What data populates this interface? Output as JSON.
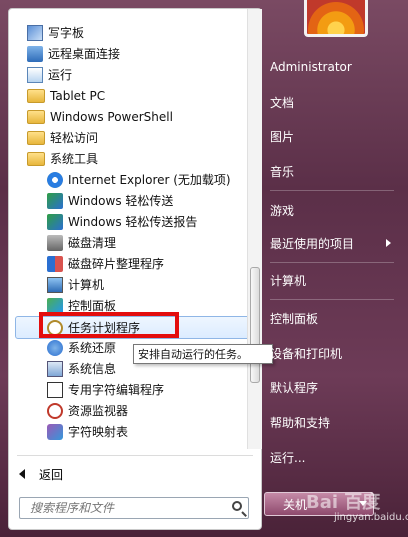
{
  "left_list": {
    "items": [
      {
        "label": "写字板",
        "icon": "wordpad-icon",
        "level": 0
      },
      {
        "label": "远程桌面连接",
        "icon": "remote-desktop-icon",
        "level": 0
      },
      {
        "label": "运行",
        "icon": "run-icon",
        "level": 0
      },
      {
        "label": "Tablet PC",
        "icon": "folder-icon",
        "level": 0
      },
      {
        "label": "Windows PowerShell",
        "icon": "folder-icon",
        "level": 0
      },
      {
        "label": "轻松访问",
        "icon": "folder-icon",
        "level": 0
      },
      {
        "label": "系统工具",
        "icon": "folder-icon",
        "level": 0
      },
      {
        "label": "Internet Explorer (无加载项)",
        "icon": "internet-explorer-icon",
        "level": 1
      },
      {
        "label": "Windows 轻松传送",
        "icon": "easy-transfer-icon",
        "level": 1
      },
      {
        "label": "Windows 轻松传送报告",
        "icon": "easy-transfer-report-icon",
        "level": 1
      },
      {
        "label": "磁盘清理",
        "icon": "disk-cleanup-icon",
        "level": 1
      },
      {
        "label": "磁盘碎片整理程序",
        "icon": "defragmenter-icon",
        "level": 1
      },
      {
        "label": "计算机",
        "icon": "computer-icon",
        "level": 1
      },
      {
        "label": "控制面板",
        "icon": "control-panel-icon",
        "level": 1
      },
      {
        "label": "任务计划程序",
        "icon": "task-scheduler-icon",
        "level": 1,
        "selected": true
      },
      {
        "label": "系统还原",
        "icon": "system-restore-icon",
        "level": 1
      },
      {
        "label": "系统信息",
        "icon": "system-info-icon",
        "level": 1
      },
      {
        "label": "专用字符编辑程序",
        "icon": "char-editor-icon",
        "level": 1
      },
      {
        "label": "资源监视器",
        "icon": "resource-monitor-icon",
        "level": 1
      },
      {
        "label": "字符映射表",
        "icon": "character-map-icon",
        "level": 1
      }
    ],
    "tooltip": "安排自动运行的任务。",
    "back_label": "返回"
  },
  "search": {
    "placeholder": "搜索程序和文件"
  },
  "right_menu": {
    "items": [
      {
        "label": "Administrator"
      },
      {
        "label": "文档"
      },
      {
        "label": "图片"
      },
      {
        "label": "音乐"
      },
      {
        "label": "游戏"
      },
      {
        "label": "最近使用的项目",
        "arrow": true
      },
      {
        "label": "计算机"
      },
      {
        "label": "控制面板"
      },
      {
        "label": "设备和打印机"
      },
      {
        "label": "默认程序"
      },
      {
        "label": "帮助和支持"
      },
      {
        "label": "运行..."
      }
    ],
    "shutdown_label": "关机"
  },
  "watermark": {
    "logo": "Bai 百度",
    "url": "jingyan.baidu.com"
  },
  "colors": {
    "highlight_border": "#e30d0d",
    "menu_bg": "#6b3a55"
  }
}
